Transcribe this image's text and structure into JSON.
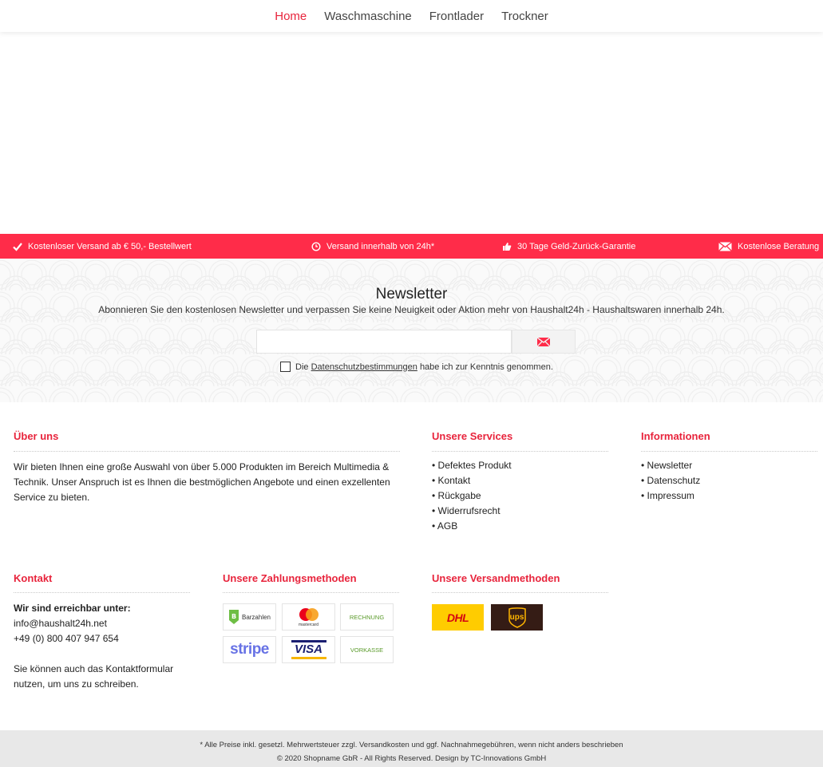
{
  "nav": {
    "items": [
      {
        "label": "Home"
      },
      {
        "label": "Waschmaschine"
      },
      {
        "label": "Frontlader"
      },
      {
        "label": "Trockner"
      }
    ]
  },
  "usp": {
    "items": [
      {
        "label": "Kostenloser Versand ab € 50,- Bestellwert",
        "icon": "check-icon"
      },
      {
        "label": "Versand innerhalb von 24h*",
        "icon": "clock-icon"
      },
      {
        "label": "30 Tage Geld-Zurück-Garantie",
        "icon": "thumbs-up-icon"
      },
      {
        "label": "Kostenlose Beratung",
        "icon": "envelope-icon"
      }
    ]
  },
  "newsletter": {
    "title": "Newsletter",
    "text": "Abonnieren Sie den kostenlosen Newsletter und verpassen Sie keine Neuigkeit oder Aktion mehr von Haushalt24h - Haushaltswaren innerhalb 24h.",
    "email_value": "",
    "consent_pre": "Die",
    "consent_link": "Datenschutzbestimmungen",
    "consent_post": "habe ich zur Kenntnis genommen."
  },
  "footer": {
    "about": {
      "title": "Über uns",
      "text": "Wir bieten Ihnen eine große Auswahl von über 5.000 Produkten im Bereich Multimedia & Technik. Unser Anspruch ist es Ihnen die bestmöglichen Angebote und einen exzellenten Service zu bieten."
    },
    "services": {
      "title": "Unsere Services",
      "items": [
        "Defektes Produkt",
        "Kontakt",
        "Rückgabe",
        "Widerrufsrecht",
        "AGB"
      ]
    },
    "info": {
      "title": "Informationen",
      "items": [
        "Newsletter",
        "Datenschutz",
        "Impressum"
      ]
    },
    "contact": {
      "title": "Kontakt",
      "reachable": "Wir sind erreichbar unter:",
      "email": "info@haushalt24h.net",
      "phone": "+49 (0) 800 407 947 654",
      "note": "Sie können auch das Kontaktformular nutzen, um uns zu schreiben."
    },
    "payment": {
      "title": "Unsere Zahlungsmethoden",
      "barzahlen": "Barzahlen",
      "mastercard": "mastercard",
      "rechnung": "RECHNUNG",
      "stripe": "stripe",
      "visa": "VISA",
      "vorkasse": "VORKASSE"
    },
    "shipping": {
      "title": "Unsere Versandmethoden",
      "dhl": "DHL",
      "ups": "ups"
    }
  },
  "bottom": {
    "line1": "* Alle Preise inkl. gesetzl. Mehrwertsteuer zzgl. Versandkosten und ggf. Nachnahmegebühren, wenn nicht anders beschrieben",
    "line2": "© 2020 Shopname GbR - All Rights Reserved. Design by TC-Innovations GmbH"
  },
  "colors": {
    "accent": "#e8243c",
    "usp_bar": "#ff2c49",
    "bottom_bar": "#e8e8e8",
    "dhl_yellow": "#ffcc00",
    "dhl_red": "#d40511",
    "ups_brown": "#351c15",
    "ups_gold": "#ffb500"
  }
}
